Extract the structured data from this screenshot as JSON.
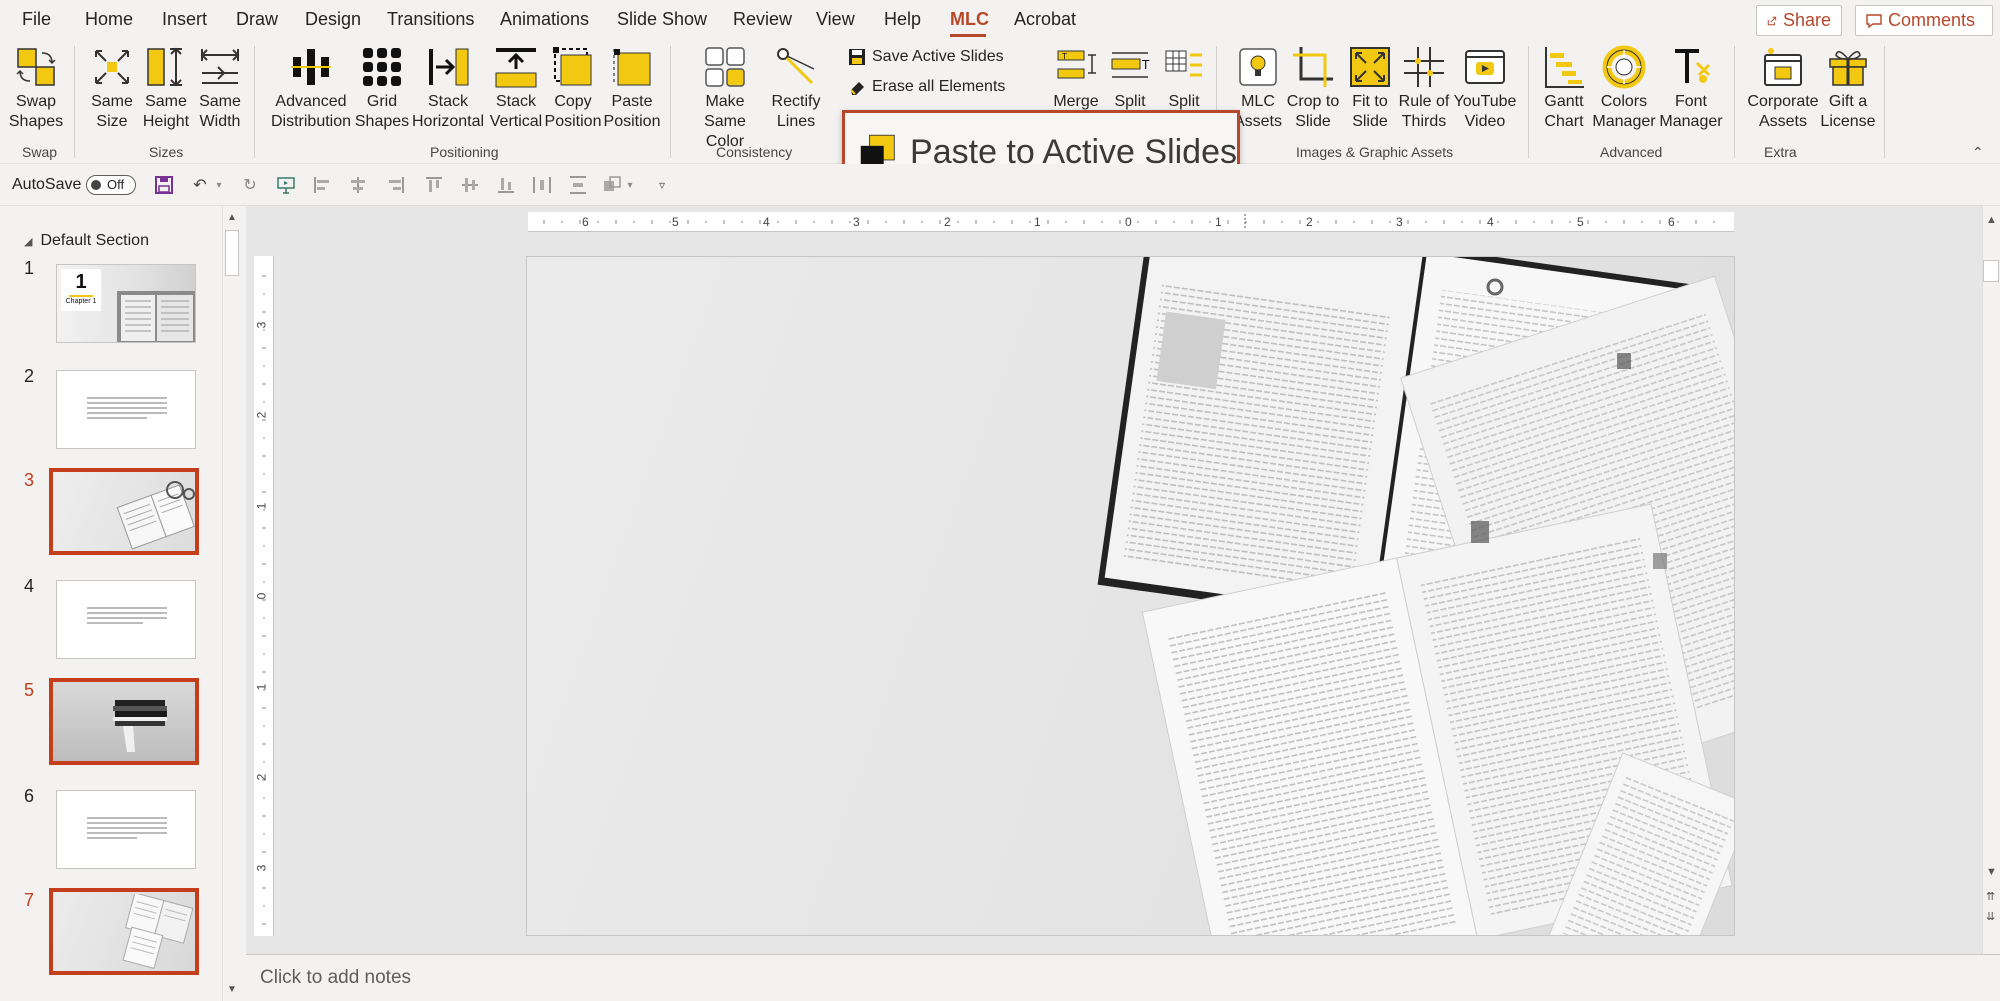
{
  "menu": {
    "tabs": [
      "File",
      "Home",
      "Insert",
      "Draw",
      "Design",
      "Transitions",
      "Animations",
      "Slide Show",
      "Review",
      "View",
      "Help",
      "MLC",
      "Acrobat"
    ],
    "active_tab": "MLC",
    "share_label": "Share",
    "comments_label": "Comments"
  },
  "ribbon": {
    "buttons": {
      "swap_shapes": "Swap\nShapes",
      "same_size": "Same\nSize",
      "same_height": "Same\nHeight",
      "same_width": "Same\nWidth",
      "advanced_distribution": "Advanced\nDistribution",
      "grid_shapes": "Grid\nShapes",
      "stack_horizontal": "Stack\nHorizontal",
      "stack_vertical": "Stack\nVertical",
      "copy_position": "Copy\nPosition",
      "paste_position": "Paste\nPosition",
      "make_same_color": "Make\nSame Color",
      "rectify_lines": "Rectify\nLines",
      "save_active_slides": "Save Active Slides",
      "erase_all_elements": "Erase all Elements",
      "merge": "Merge",
      "split_text": "Split",
      "split_table": "Split",
      "mlc_assets": "MLC\nAssets",
      "crop_to_slide": "Crop to\nSlide",
      "fit_to_slide": "Fit to\nSlide",
      "rule_of_thirds": "Rule of\nThirds",
      "youtube_video": "YouTube\nVideo",
      "gantt_chart": "Gantt\nChart",
      "colors_manager": "Colors\nManager",
      "font_manager": "Font\nManager",
      "corporate_assets": "Corporate\nAssets",
      "gift_a_license": "Gift a\nLicense"
    },
    "groups": {
      "swap": "Swap",
      "sizes": "Sizes",
      "positioning": "Positioning",
      "consistency": "Consistency",
      "images": "Images & Graphic Assets",
      "advanced": "Advanced",
      "extra": "Extra"
    }
  },
  "tooltip": {
    "label": "Paste to Active Slides"
  },
  "qat": {
    "autosave_label": "AutoSave",
    "autosave_state": "Off"
  },
  "slide_panel": {
    "section_title": "Default Section",
    "slides": [
      {
        "number": "1",
        "selected": false,
        "kind": "chapter",
        "chapter_number": "1",
        "chapter_label": "Chapter 1"
      },
      {
        "number": "2",
        "selected": false,
        "kind": "text"
      },
      {
        "number": "3",
        "selected": true,
        "kind": "image"
      },
      {
        "number": "4",
        "selected": false,
        "kind": "text"
      },
      {
        "number": "5",
        "selected": true,
        "kind": "image-dark"
      },
      {
        "number": "6",
        "selected": false,
        "kind": "text"
      },
      {
        "number": "7",
        "selected": true,
        "kind": "image"
      }
    ]
  },
  "rulers": {
    "horizontal": [
      "6",
      "5",
      "4",
      "3",
      "2",
      "1",
      "0",
      "1",
      "2",
      "3",
      "4",
      "5",
      "6"
    ],
    "vertical": [
      "3",
      "2",
      "1",
      "0",
      "1",
      "2",
      "3"
    ]
  },
  "notes": {
    "placeholder": "Click to add notes"
  },
  "colors": {
    "accent": "#b7472a",
    "selection": "#c43e1c",
    "icon_yellow": "#f2c811"
  }
}
